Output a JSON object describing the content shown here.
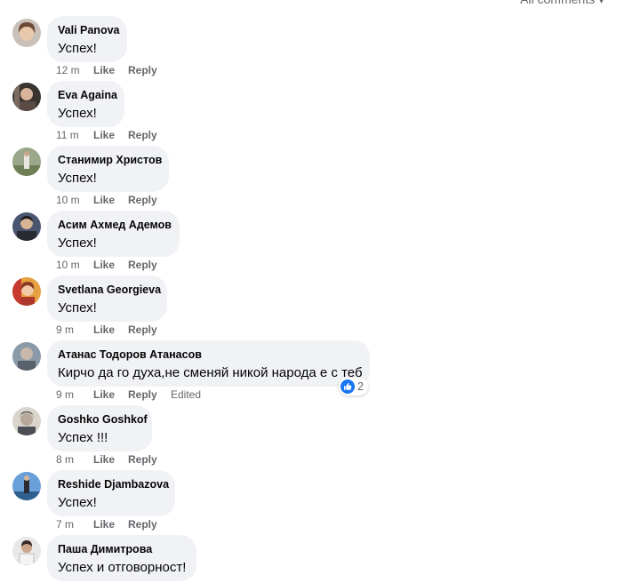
{
  "header": {
    "all_comments": "All comments ▾"
  },
  "actions": {
    "like": "Like",
    "reply": "Reply"
  },
  "colors": {
    "bubble": "#f0f2f5",
    "meta": "#65676b",
    "like_blue": "#1877f2"
  },
  "comments": [
    {
      "author": "Vali Panova",
      "text": "Успех!",
      "time": "12 m"
    },
    {
      "author": "Eva Againa",
      "text": "Успех!",
      "time": "11 m"
    },
    {
      "author": "Станимир Христов",
      "text": "Успех!",
      "time": "10 m"
    },
    {
      "author": "Асим Ахмед Адемов",
      "text": "Успех!",
      "time": "10 m"
    },
    {
      "author": "Svetlana Georgieva",
      "text": "Успех!",
      "time": "9 m"
    },
    {
      "author": "Атанас Тодоров Атанасов",
      "text": "Кирчо да го духа,не сменяй никой народа е с теб",
      "time": "9 m",
      "edited": "Edited",
      "reaction_icon": "like-icon",
      "reaction_count": "2"
    },
    {
      "author": "Goshko Goshkof",
      "text": "Успех !!!",
      "time": "8 m"
    },
    {
      "author": "Reshide Djambazova",
      "text": "Успех!",
      "time": "7 m"
    },
    {
      "author": "Паша Димитрова",
      "text": "Успех и отговорност!",
      "time": ""
    }
  ]
}
